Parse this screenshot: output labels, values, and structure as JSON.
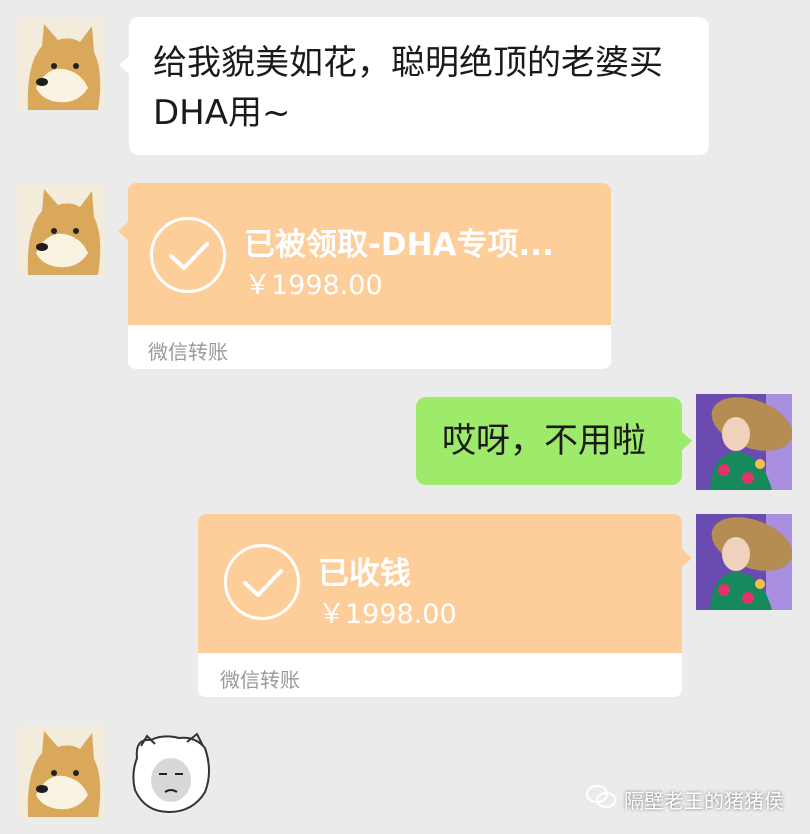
{
  "messages": {
    "m1": {
      "text_line1": "给我貌美如花，聪明绝顶的老婆买",
      "text_line2": "DHA用~"
    },
    "m2": {
      "title": "已被领取-DHA专项...",
      "amount": "￥1998.00",
      "footer": "微信转账"
    },
    "m3": {
      "text": "哎呀，不用啦"
    },
    "m4": {
      "title": "已收钱",
      "amount": "￥1998.00",
      "footer": "微信转账"
    }
  },
  "watermark": {
    "text": "隔壁老王的猪猪侯"
  },
  "colors": {
    "background": "#ebebeb",
    "green_bubble": "#9eea6a",
    "transfer_orange": "#fdcd9a",
    "white_bubble": "#ffffff"
  },
  "icons": {
    "avatar_left": "doge-avatar-icon",
    "avatar_right": "lady-avatar-icon",
    "check": "check-circle-icon",
    "sticker": "panda-face-sticker-icon",
    "watermark": "wechat-icon"
  }
}
